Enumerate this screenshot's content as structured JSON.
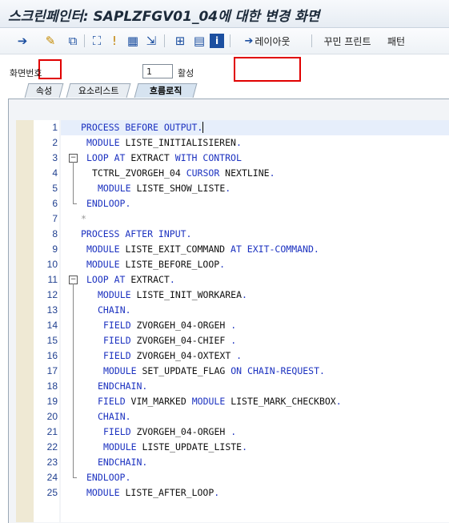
{
  "window": {
    "title": "스크린페인터: SAPLZFGV01_04에 대한 변경 화면"
  },
  "toolbar": {
    "layout_label": "레이아웃",
    "pretty_print_label": "꾸민 프린트",
    "pattern_label": "패턴"
  },
  "status": {
    "screen_no_label": "화면번호",
    "screen_no_value": "1",
    "active_label": "활성"
  },
  "tabs": [
    {
      "label": "속성"
    },
    {
      "label": "요소리스트"
    },
    {
      "label": "흐름로직"
    }
  ],
  "editor": {
    "lines": [
      {
        "n": "1",
        "indent": 0,
        "parts": [
          [
            "kw",
            "PROCESS BEFORE OUTPUT."
          ]
        ]
      },
      {
        "n": "2",
        "indent": 1,
        "parts": [
          [
            "kw",
            "MODULE "
          ],
          [
            "tx",
            "LISTE_INITIALISIEREN"
          ],
          [
            "kw",
            "."
          ]
        ]
      },
      {
        "n": "3",
        "indent": 1,
        "parts": [
          [
            "kw",
            "LOOP AT "
          ],
          [
            "tx",
            "EXTRACT "
          ],
          [
            "kw",
            "WITH CONTROL"
          ]
        ]
      },
      {
        "n": "4",
        "indent": 2,
        "parts": [
          [
            "tx",
            "TCTRL_ZVORGEH_04 "
          ],
          [
            "kw",
            "CURSOR "
          ],
          [
            "tx",
            "NEXTLINE"
          ],
          [
            "kw",
            "."
          ]
        ]
      },
      {
        "n": "5",
        "indent": 3,
        "parts": [
          [
            "kw",
            "MODULE "
          ],
          [
            "tx",
            "LISTE_SHOW_LISTE"
          ],
          [
            "kw",
            "."
          ]
        ]
      },
      {
        "n": "6",
        "indent": 1,
        "parts": [
          [
            "kw",
            "ENDLOOP."
          ]
        ]
      },
      {
        "n": "7",
        "indent": 0,
        "parts": [
          [
            "cm",
            "*"
          ]
        ]
      },
      {
        "n": "8",
        "indent": 0,
        "parts": [
          [
            "kw",
            "PROCESS AFTER INPUT."
          ]
        ]
      },
      {
        "n": "9",
        "indent": 1,
        "parts": [
          [
            "kw",
            "MODULE "
          ],
          [
            "tx",
            "LISTE_EXIT_COMMAND "
          ],
          [
            "kw",
            "AT EXIT-COMMAND."
          ]
        ]
      },
      {
        "n": "10",
        "indent": 1,
        "parts": [
          [
            "kw",
            "MODULE "
          ],
          [
            "tx",
            "LISTE_BEFORE_LOOP"
          ],
          [
            "kw",
            "."
          ]
        ]
      },
      {
        "n": "11",
        "indent": 1,
        "parts": [
          [
            "kw",
            "LOOP AT "
          ],
          [
            "tx",
            "EXTRACT"
          ],
          [
            "kw",
            "."
          ]
        ]
      },
      {
        "n": "12",
        "indent": 3,
        "parts": [
          [
            "kw",
            "MODULE "
          ],
          [
            "tx",
            "LISTE_INIT_WORKAREA"
          ],
          [
            "kw",
            "."
          ]
        ]
      },
      {
        "n": "13",
        "indent": 3,
        "parts": [
          [
            "kw",
            "CHAIN."
          ]
        ]
      },
      {
        "n": "14",
        "indent": 4,
        "parts": [
          [
            "kw",
            "FIELD "
          ],
          [
            "tx",
            "ZVORGEH_04-ORGEH "
          ],
          [
            "kw",
            "."
          ]
        ]
      },
      {
        "n": "15",
        "indent": 4,
        "parts": [
          [
            "kw",
            "FIELD "
          ],
          [
            "tx",
            "ZVORGEH_04-CHIEF "
          ],
          [
            "kw",
            "."
          ]
        ]
      },
      {
        "n": "16",
        "indent": 4,
        "parts": [
          [
            "kw",
            "FIELD "
          ],
          [
            "tx",
            "ZVORGEH_04-OXTEXT "
          ],
          [
            "kw",
            "."
          ]
        ]
      },
      {
        "n": "17",
        "indent": 4,
        "parts": [
          [
            "kw",
            "MODULE "
          ],
          [
            "tx",
            "SET_UPDATE_FLAG "
          ],
          [
            "kw",
            "ON CHAIN-REQUEST."
          ]
        ]
      },
      {
        "n": "18",
        "indent": 3,
        "parts": [
          [
            "kw",
            "ENDCHAIN."
          ]
        ]
      },
      {
        "n": "19",
        "indent": 3,
        "parts": [
          [
            "kw",
            "FIELD "
          ],
          [
            "tx",
            "VIM_MARKED "
          ],
          [
            "kw",
            "MODULE "
          ],
          [
            "tx",
            "LISTE_MARK_CHECKBOX"
          ],
          [
            "kw",
            "."
          ]
        ]
      },
      {
        "n": "20",
        "indent": 3,
        "parts": [
          [
            "kw",
            "CHAIN."
          ]
        ]
      },
      {
        "n": "21",
        "indent": 4,
        "parts": [
          [
            "kw",
            "FIELD "
          ],
          [
            "tx",
            "ZVORGEH_04-ORGEH "
          ],
          [
            "kw",
            "."
          ]
        ]
      },
      {
        "n": "22",
        "indent": 4,
        "parts": [
          [
            "kw",
            "MODULE "
          ],
          [
            "tx",
            "LISTE_UPDATE_LISTE"
          ],
          [
            "kw",
            "."
          ]
        ]
      },
      {
        "n": "23",
        "indent": 3,
        "parts": [
          [
            "kw",
            "ENDCHAIN."
          ]
        ]
      },
      {
        "n": "24",
        "indent": 1,
        "parts": [
          [
            "kw",
            "ENDLOOP."
          ]
        ]
      },
      {
        "n": "25",
        "indent": 1,
        "parts": [
          [
            "kw",
            "MODULE "
          ],
          [
            "tx",
            "LISTE_AFTER_LOOP"
          ],
          [
            "kw",
            "."
          ]
        ]
      }
    ]
  }
}
